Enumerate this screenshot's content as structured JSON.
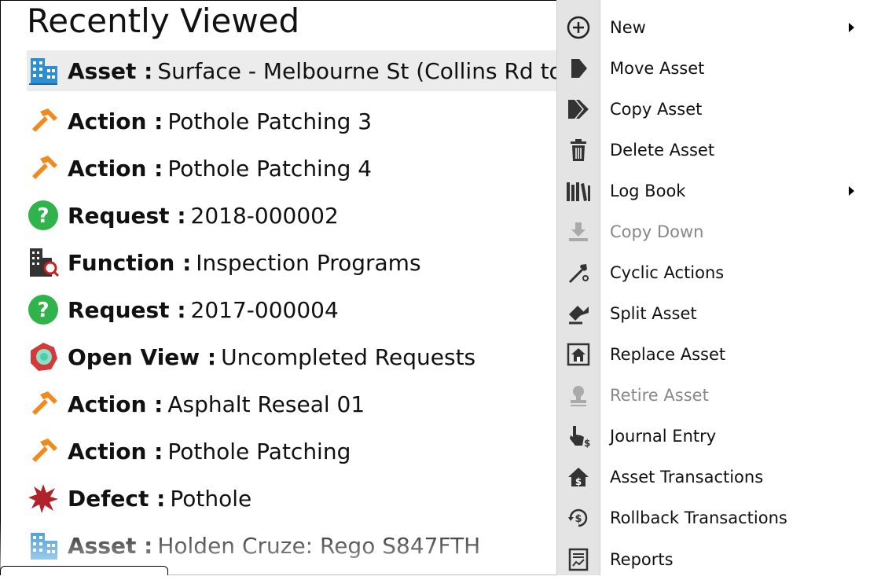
{
  "recently_viewed": {
    "title": "Recently Viewed",
    "items": [
      {
        "type": "Asset :",
        "name": "Surface - Melbourne St (Collins Rd to",
        "icon": "building-icon"
      },
      {
        "type": "Action :",
        "name": "Pothole Patching 3",
        "icon": "hammer-icon"
      },
      {
        "type": "Action :",
        "name": "Pothole Patching 4",
        "icon": "hammer-icon"
      },
      {
        "type": "Request :",
        "name": "2018-000002",
        "icon": "question-icon"
      },
      {
        "type": "Function :",
        "name": "Inspection Programs",
        "icon": "building-search-icon"
      },
      {
        "type": "Request :",
        "name": "2017-000004",
        "icon": "question-icon"
      },
      {
        "type": "Open View :",
        "name": "Uncompleted Requests",
        "icon": "open-view-icon"
      },
      {
        "type": "Action :",
        "name": "Asphalt Reseal 01",
        "icon": "hammer-icon"
      },
      {
        "type": "Action :",
        "name": "Pothole Patching",
        "icon": "hammer-icon"
      },
      {
        "type": "Defect :",
        "name": "Pothole",
        "icon": "burst-icon"
      },
      {
        "type": "Asset :",
        "name": "Holden Cruze: Rego S847FTH",
        "icon": "building-icon"
      }
    ]
  },
  "context_menu": {
    "items": [
      {
        "label": "New",
        "icon": "plus-circle-icon",
        "submenu": true,
        "disabled": false
      },
      {
        "label": "Move Asset",
        "icon": "move-arrow-icon",
        "submenu": false,
        "disabled": false
      },
      {
        "label": "Copy Asset",
        "icon": "copy-arrow-icon",
        "submenu": false,
        "disabled": false
      },
      {
        "label": "Delete Asset",
        "icon": "trash-icon",
        "submenu": false,
        "disabled": false
      },
      {
        "label": "Log Book",
        "icon": "books-icon",
        "submenu": true,
        "disabled": false
      },
      {
        "label": "Copy Down",
        "icon": "copy-down-icon",
        "submenu": false,
        "disabled": true
      },
      {
        "label": "Cyclic Actions",
        "icon": "cyclic-wrench-icon",
        "submenu": false,
        "disabled": false
      },
      {
        "label": "Split Asset",
        "icon": "split-icon",
        "submenu": false,
        "disabled": false
      },
      {
        "label": "Replace Asset",
        "icon": "replace-house-icon",
        "submenu": false,
        "disabled": false
      },
      {
        "label": "Retire Asset",
        "icon": "retire-stamp-icon",
        "submenu": false,
        "disabled": true
      },
      {
        "label": "Journal Entry",
        "icon": "journal-hand-icon",
        "submenu": false,
        "disabled": false
      },
      {
        "label": "Asset Transactions",
        "icon": "house-transactions-icon",
        "submenu": false,
        "disabled": false
      },
      {
        "label": "Rollback Transactions",
        "icon": "rollback-dollar-icon",
        "submenu": false,
        "disabled": false
      },
      {
        "label": "Reports",
        "icon": "report-icon",
        "submenu": false,
        "disabled": false
      }
    ]
  }
}
